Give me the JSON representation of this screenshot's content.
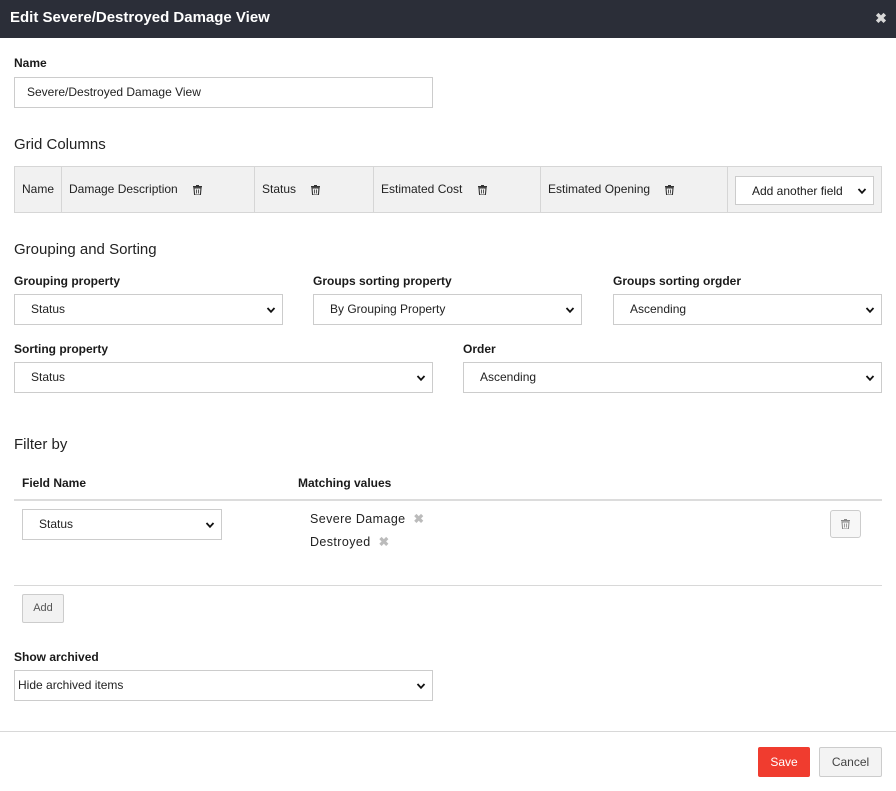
{
  "dialog": {
    "title": "Edit Severe/Destroyed Damage View",
    "close_glyph": "✖"
  },
  "name_section": {
    "label": "Name",
    "value": "Severe/Destroyed Damage View"
  },
  "grid_columns": {
    "heading": "Grid Columns",
    "columns": [
      "Name",
      "Damage Description",
      "Status",
      "Estimated Cost",
      "Estimated Opening"
    ],
    "add_field": "Add another field"
  },
  "grouping_sorting": {
    "heading": "Grouping and Sorting",
    "grouping_property": {
      "label": "Grouping property",
      "value": "Status"
    },
    "groups_sorting_property": {
      "label": "Groups sorting property",
      "value": "By Grouping Property"
    },
    "groups_sorting_order": {
      "label": "Groups sorting orgder",
      "value": "Ascending"
    },
    "sorting_property": {
      "label": "Sorting property",
      "value": "Status"
    },
    "order": {
      "label": "Order",
      "value": "Ascending"
    }
  },
  "filter": {
    "heading": "Filter by",
    "col_field_name": "Field Name",
    "col_matching_values": "Matching values",
    "row": {
      "field": "Status",
      "values": [
        "Severe Damage",
        "Destroyed"
      ]
    },
    "add_label": "Add"
  },
  "archived": {
    "label": "Show archived",
    "value": "Hide archived items"
  },
  "footer": {
    "save_label": "Save",
    "cancel_label": "Cancel"
  },
  "colors": {
    "titlebar": "#2b2e38",
    "save_button": "#f03c2f"
  }
}
